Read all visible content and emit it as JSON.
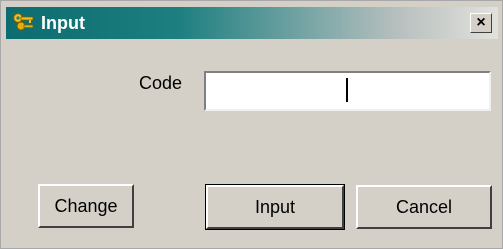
{
  "window": {
    "title": "Input",
    "close_label": "×",
    "title_icon": "keys-icon",
    "colors": {
      "titlebar_start": "#0c6c6f",
      "titlebar_end": "#e2e2dc",
      "face": "#d4d0c8"
    }
  },
  "form": {
    "code_label": "Code",
    "code_value": ""
  },
  "buttons": {
    "change": "Change",
    "input": "Input",
    "cancel": "Cancel"
  }
}
